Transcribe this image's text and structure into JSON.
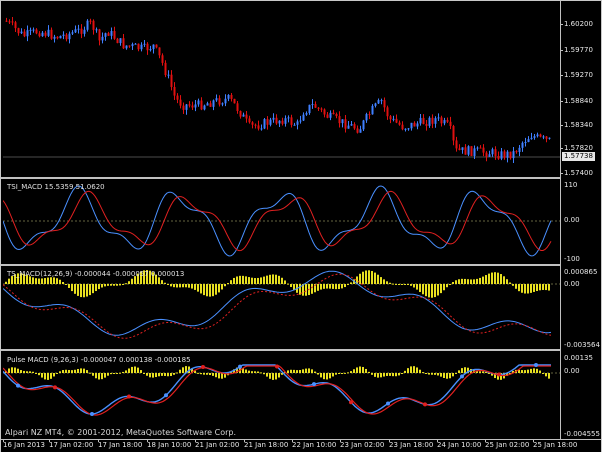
{
  "main_chart": {
    "symbol_price_tag": "1.57738",
    "y_ticks": [
      "1.60200",
      "1.59770",
      "1.59270",
      "1.58840",
      "1.58340",
      "1.57820",
      "1.57400"
    ]
  },
  "tsi_macd": {
    "title": "TSI_MACD 15.5359 51.0620",
    "y_ticks": [
      "110",
      "0.00",
      "-100"
    ]
  },
  "ts_macd": {
    "title": "TS_MACD(12,26,9) -0.000044 -0.000057 0.000013",
    "y_ticks": [
      "0.000865",
      "0.00",
      "-0.003564"
    ]
  },
  "pulse_macd": {
    "title": "Pulse MACD (9,26,3) -0.000047 0.000138 -0.000185",
    "y_ticks": [
      "0.00135",
      "0.00",
      "-0.004555"
    ]
  },
  "footer_credit": "Alpari NZ MT4, © 2001-2012, MetaQuotes Software Corp.",
  "time_axis": [
    "16 Jan 2013",
    "17 Jan 02:00",
    "17 Jan 18:00",
    "18 Jan 10:00",
    "21 Jan 02:00",
    "21 Jan 18:00",
    "22 Jan 10:00",
    "23 Jan 02:00",
    "23 Jan 18:00",
    "24 Jan 10:00",
    "25 Jan 02:00",
    "25 Jan 18:00"
  ],
  "colors": {
    "background": "#000000",
    "bull_candle": "#3f7fff",
    "bear_candle": "#e01010",
    "line_blue": "#4a90ff",
    "line_red": "#e02020",
    "histogram": "#e8e020",
    "zero_line": "#c8c880"
  }
}
